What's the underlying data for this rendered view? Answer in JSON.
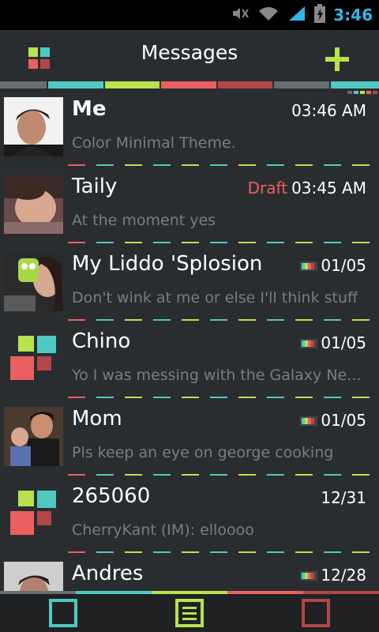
{
  "status": {
    "time": "3:46"
  },
  "header": {
    "title": "Messages"
  },
  "colors": {
    "background": "#2a2d2f",
    "teal": "#4fc9c2",
    "lime": "#b7e34e",
    "coral": "#ea6060",
    "darkred": "#b2474a",
    "gray": "#6a6d70"
  },
  "conversations": [
    {
      "name": "Me",
      "time": "03:46 AM",
      "draft_label": "",
      "snippet": "Color Minimal Theme.",
      "avatar_icon": "photo-avatar",
      "attachment": false
    },
    {
      "name": "Taily",
      "time": "03:45 AM",
      "draft_label": "Draft",
      "snippet": "At the moment yes",
      "avatar_icon": "photo-avatar",
      "attachment": false
    },
    {
      "name": "My Liddo 'Splosion",
      "time": "01/05",
      "draft_label": "",
      "snippet": "Don't wink at me or else I'll think stuff",
      "avatar_icon": "photo-avatar",
      "attachment": true
    },
    {
      "name": "Chino",
      "time": "01/05",
      "draft_label": "",
      "snippet": "Yo I was messing with the Galaxy Nex...",
      "avatar_icon": "default-contact-icon",
      "attachment": true
    },
    {
      "name": "Mom",
      "time": "01/05",
      "draft_label": "",
      "snippet": "Pls keep an eye on george cooking",
      "avatar_icon": "photo-avatar",
      "attachment": true
    },
    {
      "name": "265060",
      "time": "12/31",
      "draft_label": "",
      "snippet": "CherryKant (IM):  elloooo",
      "avatar_icon": "default-contact-icon",
      "attachment": false
    },
    {
      "name": "Andres",
      "time": "12/28",
      "draft_label": "",
      "snippet": "",
      "avatar_icon": "photo-avatar",
      "attachment": true
    }
  ],
  "bottom_nav": [
    "conversations-tab",
    "compose-tab",
    "settings-tab"
  ]
}
